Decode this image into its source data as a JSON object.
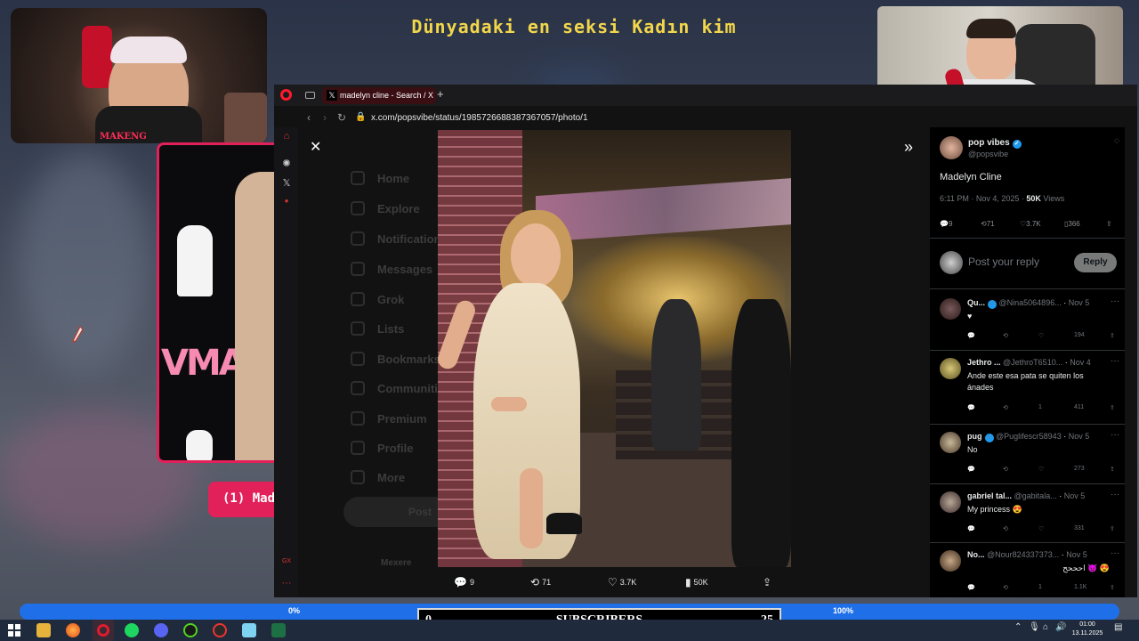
{
  "overlay": {
    "title": "Dünyadaki en seksi Kadın kim",
    "cam_tag": "MAKENG",
    "vma_text": "VMA",
    "chat_pill": "(1) Mad",
    "progress_start": "0%",
    "progress_end": "100%",
    "subs_current": "0",
    "subs_label": "SUBSCRIBERS",
    "subs_goal": "25"
  },
  "browser": {
    "tab_title": "madelyn cline - Search / X",
    "url": "x.com/popsvibe/status/1985726688387367057/photo/1"
  },
  "xnav": [
    "Home",
    "Explore",
    "Notifications",
    "Messages",
    "Grok",
    "Lists",
    "Bookmarks",
    "Communities",
    "Premium",
    "Profile",
    "More"
  ],
  "xnav_post": "Post",
  "xnav_account": "Mexere",
  "post": {
    "author": "pop vibes",
    "handle": "@popsvibe",
    "text": "Madelyn Cline",
    "timestamp": "6:11 PM · Nov 4, 2025",
    "views": "50K",
    "views_label": "Views",
    "replies": "9",
    "reposts": "71",
    "likes": "3.7K",
    "bookmarks": "366",
    "views_short": "50K",
    "reply_placeholder": "Post your reply",
    "reply_button": "Reply"
  },
  "replies": [
    {
      "name": "Qu...",
      "handle": "@Nina5064896...",
      "date": "Nov 5",
      "text": "♥",
      "views": "194"
    },
    {
      "name": "Jethro ...",
      "handle": "@JethroT6510...",
      "date": "Nov 4",
      "text": "Ande este esa pata se quiten los ánades",
      "likes": "1",
      "views": "411"
    },
    {
      "name": "pug",
      "handle": "@Puglifescr58943",
      "date": "Nov 5",
      "text": "No",
      "views": "273"
    },
    {
      "name": "gabriel tal...",
      "handle": "@gabitala...",
      "date": "Nov 5",
      "text": "My princess 😍",
      "views": "331"
    },
    {
      "name": "No...",
      "handle": "@Nour824337373...",
      "date": "Nov 5",
      "text": "احححح 😈 😍",
      "likes": "1",
      "views": "1.1K"
    }
  ],
  "taskbar": {
    "time": "01:00",
    "date": "13.11.2025"
  }
}
